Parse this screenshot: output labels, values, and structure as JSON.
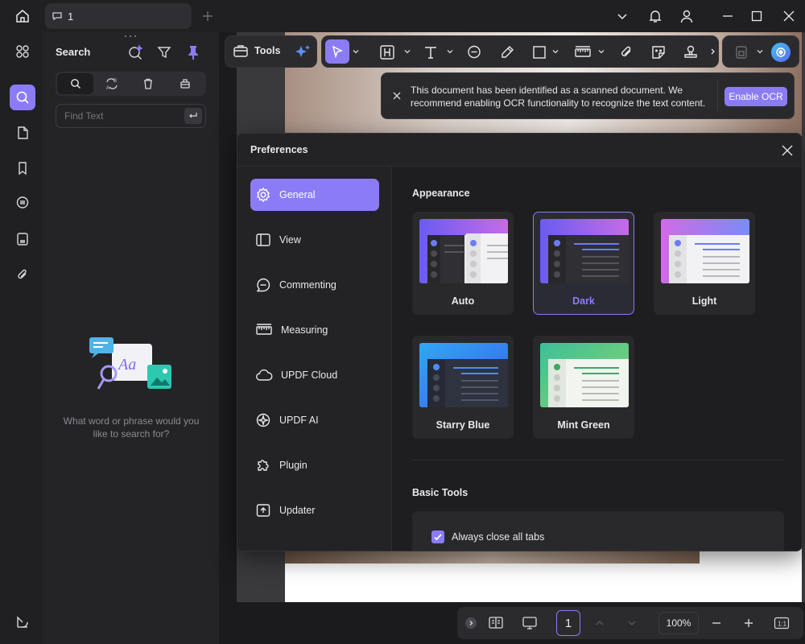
{
  "tab": {
    "label": "1"
  },
  "search_panel": {
    "title": "Search",
    "input_placeholder": "Find Text",
    "empty_message": "What word or phrase would you like to search for?"
  },
  "toolbar": {
    "tools_label": "Tools"
  },
  "ocr_banner": {
    "message": "This document has been identified as a scanned document. We recommend enabling OCR functionality to recognize the text content.",
    "button": "Enable OCR"
  },
  "preferences": {
    "title": "Preferences",
    "nav": [
      {
        "label": "General",
        "icon": "gear-icon",
        "active": true
      },
      {
        "label": "View",
        "icon": "view-icon"
      },
      {
        "label": "Commenting",
        "icon": "comment-icon"
      },
      {
        "label": "Measuring",
        "icon": "ruler-icon"
      },
      {
        "label": "UPDF Cloud",
        "icon": "cloud-icon"
      },
      {
        "label": "UPDF AI",
        "icon": "ai-icon"
      },
      {
        "label": "Plugin",
        "icon": "puzzle-icon"
      },
      {
        "label": "Updater",
        "icon": "updater-icon"
      }
    ],
    "appearance": {
      "heading": "Appearance",
      "themes": [
        {
          "label": "Auto",
          "selected": false
        },
        {
          "label": "Dark",
          "selected": true
        },
        {
          "label": "Light",
          "selected": false
        },
        {
          "label": "Starry Blue",
          "selected": false
        },
        {
          "label": "Mint Green",
          "selected": false
        }
      ]
    },
    "basic_tools": {
      "heading": "Basic Tools",
      "checkbox_label": "Always close all tabs",
      "checked": true
    }
  },
  "statusbar": {
    "page_number": "1",
    "zoom": "100%"
  },
  "colors": {
    "accent": "#8b7cf6",
    "background": "#1b1b1d"
  }
}
